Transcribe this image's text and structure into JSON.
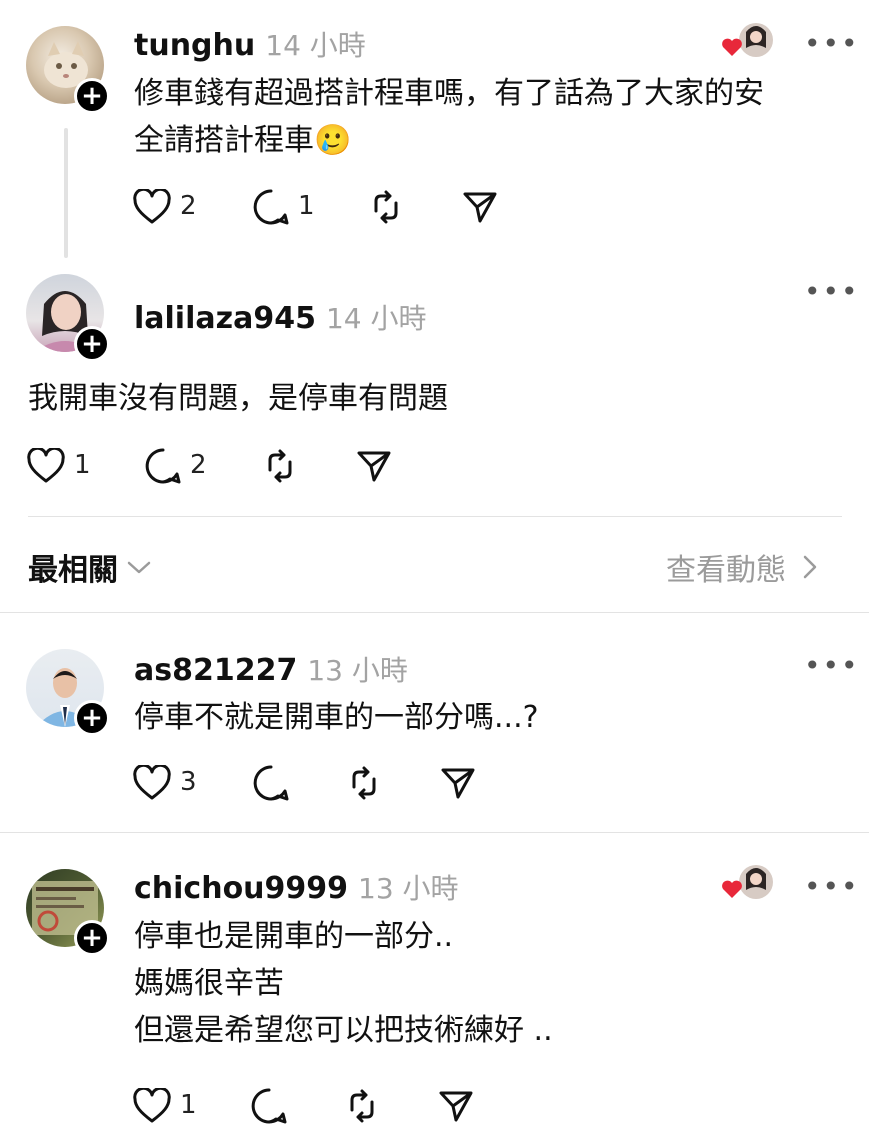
{
  "comments": [
    {
      "username": "tunghu",
      "time": "14 小時",
      "lines": [
        "修車錢有超過搭計程車嗎，有了話為了大家的安",
        "全請搭計程車🥲"
      ],
      "likes": "2",
      "replies": "1",
      "liked_by_author": true
    },
    {
      "username": "lalilaza945",
      "time": "14 小時",
      "lines": [
        "我開車沒有問題，是停車有問題"
      ],
      "likes": "1",
      "replies": "2"
    },
    {
      "username": "as821227",
      "time": "13 小時",
      "lines": [
        "停車不就是開車的一部分嗎...?"
      ],
      "likes": "3",
      "replies": ""
    },
    {
      "username": "chichou9999",
      "time": "13 小時",
      "lines": [
        "停車也是開車的一部分..",
        "媽媽很辛苦",
        "但還是希望您可以把技術練好 .."
      ],
      "likes": "1",
      "replies": "",
      "liked_by_author": true
    }
  ],
  "sort_bar": {
    "label": "最相關",
    "activity_link": "查看動態"
  },
  "more_menu": "•••",
  "follow_symbol": "+",
  "colors": {
    "heart_red": "#e8283a",
    "time_gray": "#a3a3a3"
  }
}
